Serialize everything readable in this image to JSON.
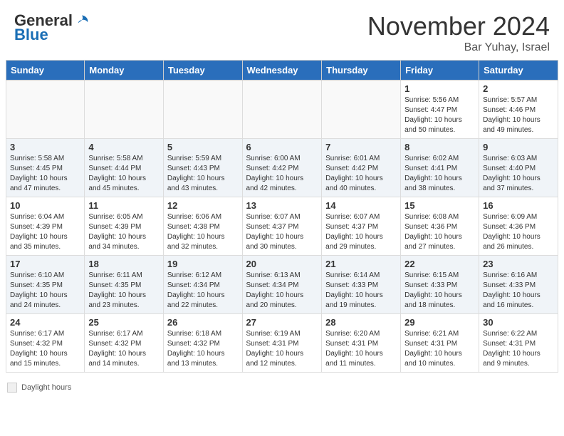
{
  "header": {
    "logo_general": "General",
    "logo_blue": "Blue",
    "month_title": "November 2024",
    "location": "Bar Yuhay, Israel"
  },
  "footer": {
    "daylight_label": "Daylight hours"
  },
  "days_of_week": [
    "Sunday",
    "Monday",
    "Tuesday",
    "Wednesday",
    "Thursday",
    "Friday",
    "Saturday"
  ],
  "weeks": [
    {
      "cells": [
        {
          "day": null,
          "detail": ""
        },
        {
          "day": null,
          "detail": ""
        },
        {
          "day": null,
          "detail": ""
        },
        {
          "day": null,
          "detail": ""
        },
        {
          "day": null,
          "detail": ""
        },
        {
          "day": "1",
          "detail": "Sunrise: 5:56 AM\nSunset: 4:47 PM\nDaylight: 10 hours\nand 50 minutes."
        },
        {
          "day": "2",
          "detail": "Sunrise: 5:57 AM\nSunset: 4:46 PM\nDaylight: 10 hours\nand 49 minutes."
        }
      ]
    },
    {
      "cells": [
        {
          "day": "3",
          "detail": "Sunrise: 5:58 AM\nSunset: 4:45 PM\nDaylight: 10 hours\nand 47 minutes."
        },
        {
          "day": "4",
          "detail": "Sunrise: 5:58 AM\nSunset: 4:44 PM\nDaylight: 10 hours\nand 45 minutes."
        },
        {
          "day": "5",
          "detail": "Sunrise: 5:59 AM\nSunset: 4:43 PM\nDaylight: 10 hours\nand 43 minutes."
        },
        {
          "day": "6",
          "detail": "Sunrise: 6:00 AM\nSunset: 4:42 PM\nDaylight: 10 hours\nand 42 minutes."
        },
        {
          "day": "7",
          "detail": "Sunrise: 6:01 AM\nSunset: 4:42 PM\nDaylight: 10 hours\nand 40 minutes."
        },
        {
          "day": "8",
          "detail": "Sunrise: 6:02 AM\nSunset: 4:41 PM\nDaylight: 10 hours\nand 38 minutes."
        },
        {
          "day": "9",
          "detail": "Sunrise: 6:03 AM\nSunset: 4:40 PM\nDaylight: 10 hours\nand 37 minutes."
        }
      ]
    },
    {
      "cells": [
        {
          "day": "10",
          "detail": "Sunrise: 6:04 AM\nSunset: 4:39 PM\nDaylight: 10 hours\nand 35 minutes."
        },
        {
          "day": "11",
          "detail": "Sunrise: 6:05 AM\nSunset: 4:39 PM\nDaylight: 10 hours\nand 34 minutes."
        },
        {
          "day": "12",
          "detail": "Sunrise: 6:06 AM\nSunset: 4:38 PM\nDaylight: 10 hours\nand 32 minutes."
        },
        {
          "day": "13",
          "detail": "Sunrise: 6:07 AM\nSunset: 4:37 PM\nDaylight: 10 hours\nand 30 minutes."
        },
        {
          "day": "14",
          "detail": "Sunrise: 6:07 AM\nSunset: 4:37 PM\nDaylight: 10 hours\nand 29 minutes."
        },
        {
          "day": "15",
          "detail": "Sunrise: 6:08 AM\nSunset: 4:36 PM\nDaylight: 10 hours\nand 27 minutes."
        },
        {
          "day": "16",
          "detail": "Sunrise: 6:09 AM\nSunset: 4:36 PM\nDaylight: 10 hours\nand 26 minutes."
        }
      ]
    },
    {
      "cells": [
        {
          "day": "17",
          "detail": "Sunrise: 6:10 AM\nSunset: 4:35 PM\nDaylight: 10 hours\nand 24 minutes."
        },
        {
          "day": "18",
          "detail": "Sunrise: 6:11 AM\nSunset: 4:35 PM\nDaylight: 10 hours\nand 23 minutes."
        },
        {
          "day": "19",
          "detail": "Sunrise: 6:12 AM\nSunset: 4:34 PM\nDaylight: 10 hours\nand 22 minutes."
        },
        {
          "day": "20",
          "detail": "Sunrise: 6:13 AM\nSunset: 4:34 PM\nDaylight: 10 hours\nand 20 minutes."
        },
        {
          "day": "21",
          "detail": "Sunrise: 6:14 AM\nSunset: 4:33 PM\nDaylight: 10 hours\nand 19 minutes."
        },
        {
          "day": "22",
          "detail": "Sunrise: 6:15 AM\nSunset: 4:33 PM\nDaylight: 10 hours\nand 18 minutes."
        },
        {
          "day": "23",
          "detail": "Sunrise: 6:16 AM\nSunset: 4:33 PM\nDaylight: 10 hours\nand 16 minutes."
        }
      ]
    },
    {
      "cells": [
        {
          "day": "24",
          "detail": "Sunrise: 6:17 AM\nSunset: 4:32 PM\nDaylight: 10 hours\nand 15 minutes."
        },
        {
          "day": "25",
          "detail": "Sunrise: 6:17 AM\nSunset: 4:32 PM\nDaylight: 10 hours\nand 14 minutes."
        },
        {
          "day": "26",
          "detail": "Sunrise: 6:18 AM\nSunset: 4:32 PM\nDaylight: 10 hours\nand 13 minutes."
        },
        {
          "day": "27",
          "detail": "Sunrise: 6:19 AM\nSunset: 4:31 PM\nDaylight: 10 hours\nand 12 minutes."
        },
        {
          "day": "28",
          "detail": "Sunrise: 6:20 AM\nSunset: 4:31 PM\nDaylight: 10 hours\nand 11 minutes."
        },
        {
          "day": "29",
          "detail": "Sunrise: 6:21 AM\nSunset: 4:31 PM\nDaylight: 10 hours\nand 10 minutes."
        },
        {
          "day": "30",
          "detail": "Sunrise: 6:22 AM\nSunset: 4:31 PM\nDaylight: 10 hours\nand 9 minutes."
        }
      ]
    }
  ]
}
